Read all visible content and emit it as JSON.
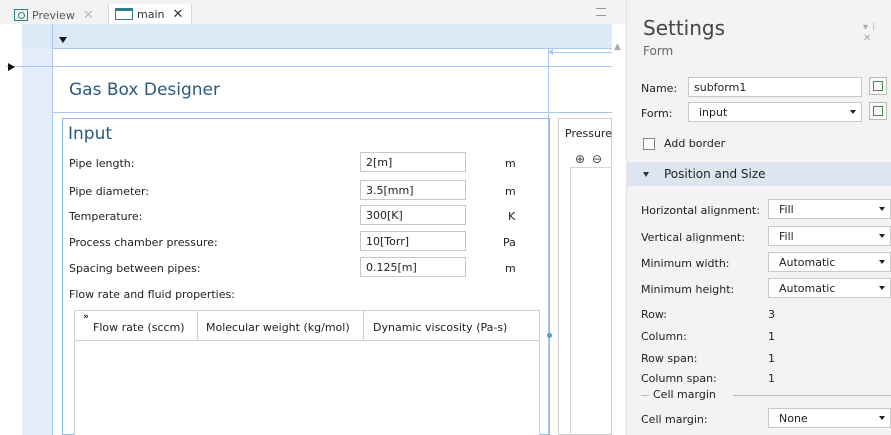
{
  "tabs": [
    {
      "label": "Preview",
      "icon": "preview-icon"
    },
    {
      "label": "main",
      "icon": "folder-icon"
    }
  ],
  "canvas": {
    "app_title": "Gas Box Designer",
    "input_panel": {
      "title": "Input",
      "fields": [
        {
          "label": "Pipe length:",
          "value": "2[m]",
          "unit": "m"
        },
        {
          "label": "Pipe diameter:",
          "value": "3.5[mm]",
          "unit": "m"
        },
        {
          "label": "Temperature:",
          "value": "300[K]",
          "unit": "K"
        },
        {
          "label": "Process chamber pressure:",
          "value": "10[Torr]",
          "unit": "Pa"
        },
        {
          "label": "Spacing between pipes:",
          "value": "0.125[m]",
          "unit": "m"
        }
      ],
      "table_label": "Flow rate and fluid properties:",
      "table_columns": [
        "Flow rate (sccm)",
        "Molecular weight (kg/mol)",
        "Dynamic viscosity (Pa-s)"
      ]
    },
    "pressure_panel": {
      "title": "Pressure"
    }
  },
  "settings": {
    "title": "Settings",
    "subtitle": "Form",
    "name_label": "Name:",
    "name_value": "subform1",
    "form_label": "Form:",
    "form_value": "input",
    "add_border_label": "Add border",
    "add_border_checked": false,
    "section_title": "Position and Size",
    "horizontal_alignment_label": "Horizontal alignment:",
    "horizontal_alignment_value": "Fill",
    "vertical_alignment_label": "Vertical alignment:",
    "vertical_alignment_value": "Fill",
    "minimum_width_label": "Minimum width:",
    "minimum_width_value": "Automatic",
    "minimum_height_label": "Minimum height:",
    "minimum_height_value": "Automatic",
    "row_label": "Row:",
    "row_value": "3",
    "column_label": "Column:",
    "column_value": "1",
    "row_span_label": "Row span:",
    "row_span_value": "1",
    "column_span_label": "Column span:",
    "column_span_value": "1",
    "cell_margin_group": "Cell margin",
    "cell_margin_label": "Cell margin:",
    "cell_margin_value": "None"
  },
  "colors": {
    "accent": "#2a5a80",
    "guide": "#a9c8ec",
    "section": "#dde5f0"
  }
}
